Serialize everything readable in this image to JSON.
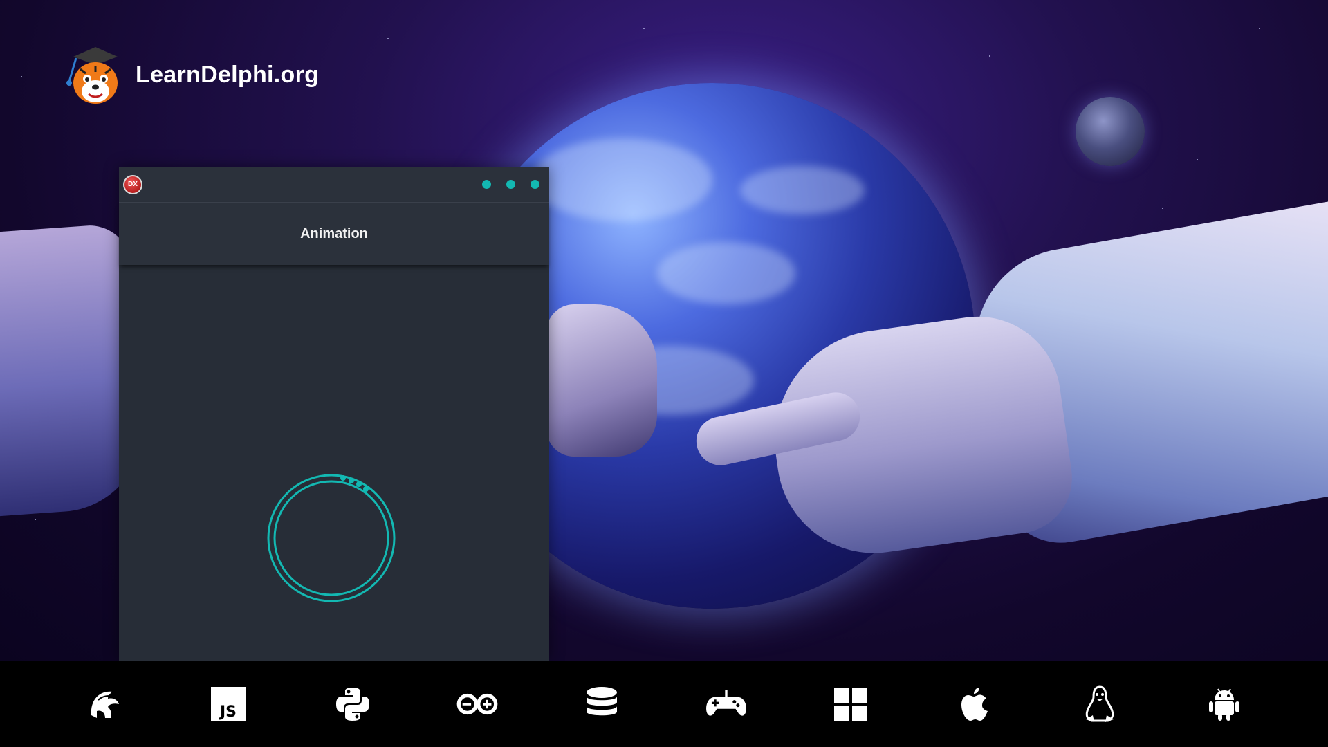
{
  "brand": {
    "name": "LearnDelphi.org",
    "logo_icon": "tiger-graduate-icon"
  },
  "window": {
    "app_icon_label": "DX",
    "controls": [
      "minimize-dot",
      "maximize-dot",
      "close-dot"
    ],
    "accent_color": "#13b8b2",
    "background_color": "#272d37",
    "header": {
      "title": "Animation"
    },
    "spinner": {
      "icon": "loading-ring-icon",
      "color": "#13b8b2"
    }
  },
  "bottom_bar": {
    "icons": [
      "delphi-helmet-icon",
      "javascript-icon",
      "python-icon",
      "arduino-icon",
      "database-icon",
      "gamepad-icon",
      "windows-icon",
      "apple-icon",
      "linux-icon",
      "android-icon"
    ],
    "javascript_label": "JS"
  }
}
